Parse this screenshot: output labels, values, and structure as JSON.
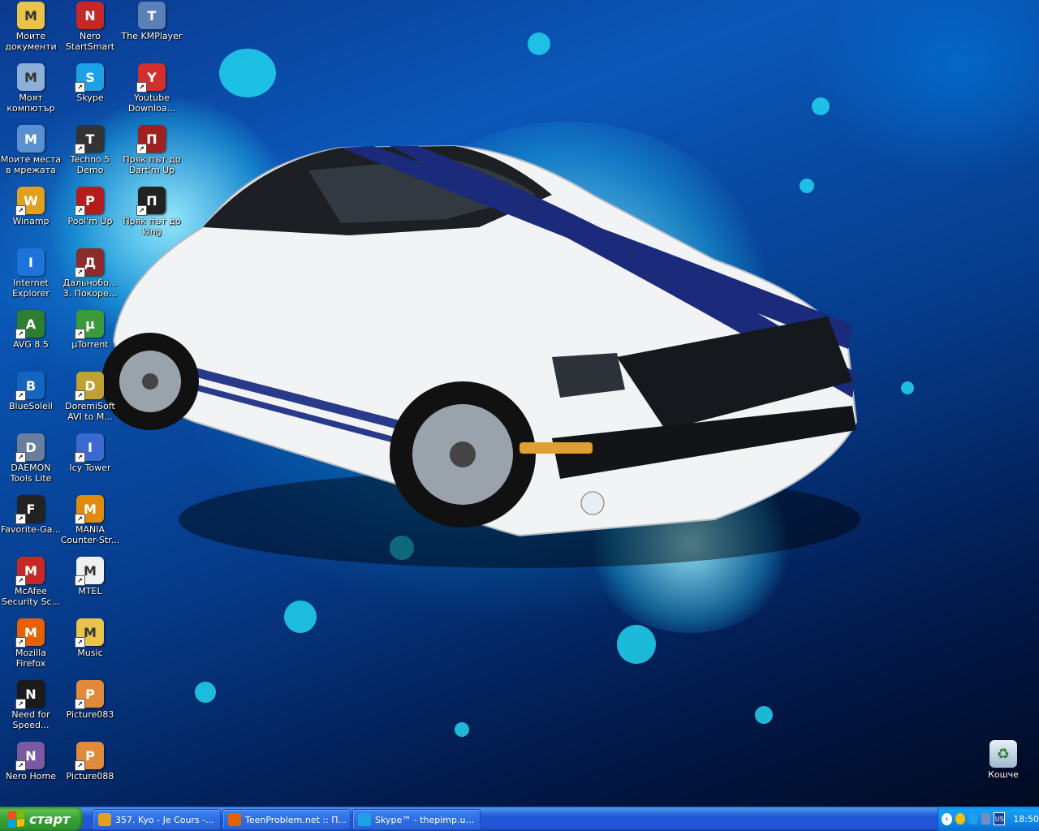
{
  "desktop": {
    "icons": [
      {
        "label": "Моите документи",
        "icon": "my-documents-icon",
        "color": "#e9c34a"
      },
      {
        "label": "Nero StartSmart",
        "icon": "nero-startsmart-icon",
        "color": "#c62828"
      },
      {
        "label": "The KMPlayer",
        "icon": "kmplayer-icon",
        "color": "#5b7fb7"
      },
      {
        "label": "Моят компютър",
        "icon": "my-computer-icon",
        "color": "#8db0d8"
      },
      {
        "label": "Skype",
        "icon": "skype-icon",
        "color": "#1ea0e6"
      },
      {
        "label": "Youtube Downloa...",
        "icon": "youtube-downloader-icon",
        "color": "#d32f2f"
      },
      {
        "label": "Моите места в мрежата",
        "icon": "network-places-icon",
        "color": "#5a8fd0"
      },
      {
        "label": "Techno 5 Demo",
        "icon": "techno5-demo-icon",
        "color": "#333333"
      },
      {
        "label": "Пряк път до Dart'm Up",
        "icon": "dart-icon",
        "color": "#a02020"
      },
      {
        "label": "Winamp",
        "icon": "winamp-icon",
        "color": "#e0a020"
      },
      {
        "label": "Pool'm Up",
        "icon": "pool-ball-icon",
        "color": "#b71c1c"
      },
      {
        "label": "Пряк път до king",
        "icon": "king-icon",
        "color": "#222222"
      },
      {
        "label": "Internet Explorer",
        "icon": "internet-explorer-icon",
        "color": "#1e73d8"
      },
      {
        "label": "Дальнобо... 3. Покоре...",
        "icon": "truck-game-icon",
        "color": "#8d2a2a"
      },
      {
        "label": "AVG 8.5",
        "icon": "avg-icon",
        "color": "#2e7d32"
      },
      {
        "label": "µTorrent",
        "icon": "utorrent-icon",
        "color": "#3a9a3a"
      },
      {
        "label": "BlueSoleil",
        "icon": "bluetooth-icon",
        "color": "#1565c0"
      },
      {
        "label": "DoremiSoft AVI to M...",
        "icon": "doremisoft-icon",
        "color": "#c0a030"
      },
      {
        "label": "DAEMON Tools Lite",
        "icon": "daemon-tools-icon",
        "color": "#6a7fa0"
      },
      {
        "label": "Icy Tower",
        "icon": "icy-tower-icon",
        "color": "#3a6ad0"
      },
      {
        "label": "Favorite-Ga...",
        "icon": "favorite-games-icon",
        "color": "#222222"
      },
      {
        "label": "MANIA Counter-Str...",
        "icon": "half-life-icon",
        "color": "#e08a10"
      },
      {
        "label": "McAfee Security Sc...",
        "icon": "mcafee-icon",
        "color": "#c62828"
      },
      {
        "label": "MTEL",
        "icon": "text-document-icon",
        "color": "#f0f0f0"
      },
      {
        "label": "Mozilla Firefox",
        "icon": "firefox-icon",
        "color": "#e66000"
      },
      {
        "label": "Music",
        "icon": "folder-icon",
        "color": "#e9c34a"
      },
      {
        "label": "Need for Speed...",
        "icon": "need-for-speed-icon",
        "color": "#1b1b1b"
      },
      {
        "label": "Picture083",
        "icon": "image-file-icon",
        "color": "#e08a3a"
      },
      {
        "label": "Nero Home",
        "icon": "nero-home-icon",
        "color": "#7a5aa0"
      },
      {
        "label": "Picture088",
        "icon": "image-file-icon",
        "color": "#e08a3a"
      }
    ],
    "recycle_bin": {
      "label": "Кошче",
      "icon": "recycle-bin-icon"
    }
  },
  "taskbar": {
    "start_label": "старт",
    "tasks": [
      {
        "label": "357. Kyo - Je Cours -...",
        "icon": "winamp-icon",
        "color": "#e0a020"
      },
      {
        "label": "TeenProblem.net :: П...",
        "icon": "firefox-icon",
        "color": "#e66000"
      },
      {
        "label": "Skype™ - thepimp.umrq",
        "icon": "skype-icon",
        "color": "#1ea0e6"
      }
    ],
    "tray": {
      "language": "US",
      "clock": "18:50"
    }
  }
}
